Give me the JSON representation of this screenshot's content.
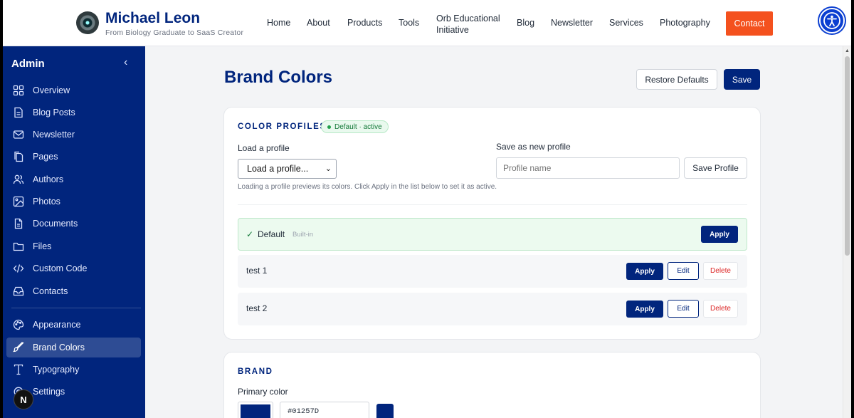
{
  "header": {
    "site_name": "Michael Leon",
    "tagline": "From Biology Graduate to SaaS Creator",
    "nav": [
      "Home",
      "About",
      "Products",
      "Tools",
      "Orb Educational Initiative",
      "Blog",
      "Newsletter",
      "Services",
      "Photography"
    ],
    "contact_label": "Contact",
    "accent_color": "#f4511e",
    "accessibility_icon": "accessibility-icon"
  },
  "sidebar": {
    "title": "Admin",
    "collapse_icon": "chevron-left-icon",
    "items": [
      {
        "label": "Overview",
        "icon": "grid-icon"
      },
      {
        "label": "Blog Posts",
        "icon": "file-text-icon"
      },
      {
        "label": "Newsletter",
        "icon": "mail-icon"
      },
      {
        "label": "Pages",
        "icon": "copy-icon"
      },
      {
        "label": "Authors",
        "icon": "users-icon"
      },
      {
        "label": "Photos",
        "icon": "image-icon"
      },
      {
        "label": "Documents",
        "icon": "document-icon"
      },
      {
        "label": "Files",
        "icon": "folder-icon"
      },
      {
        "label": "Custom Code",
        "icon": "code-icon"
      },
      {
        "label": "Contacts",
        "icon": "inbox-icon"
      }
    ],
    "items2": [
      {
        "label": "Appearance",
        "icon": "palette-icon"
      },
      {
        "label": "Brand Colors",
        "icon": "brush-icon",
        "active": true
      },
      {
        "label": "Typography",
        "icon": "type-icon"
      },
      {
        "label": "Settings",
        "icon": "settings-icon"
      }
    ],
    "badge": "N",
    "bg_color": "#01257D"
  },
  "main": {
    "title": "Brand Colors",
    "restore_label": "Restore Defaults",
    "save_label": "Save",
    "profiles": {
      "heading": "COLOR PROFILES",
      "active_badge": "Default · active",
      "load_label": "Load a profile",
      "load_selected": "Load a profile...",
      "save_new_label": "Save as new profile",
      "profile_name_placeholder": "Profile name",
      "save_profile_label": "Save Profile",
      "help": "Loading a profile previews its colors. Click Apply in the list below to set it as active.",
      "list": [
        {
          "check": "✓",
          "name": "Default",
          "tag": "Built-in",
          "apply": "Apply"
        },
        {
          "name": "test 1",
          "apply": "Apply",
          "edit": "Edit",
          "delete": "Delete"
        },
        {
          "name": "test 2",
          "apply": "Apply",
          "edit": "Edit",
          "delete": "Delete"
        }
      ]
    },
    "brand": {
      "heading": "BRAND",
      "primary_label": "Primary color",
      "primary_value": "#01257D"
    }
  }
}
